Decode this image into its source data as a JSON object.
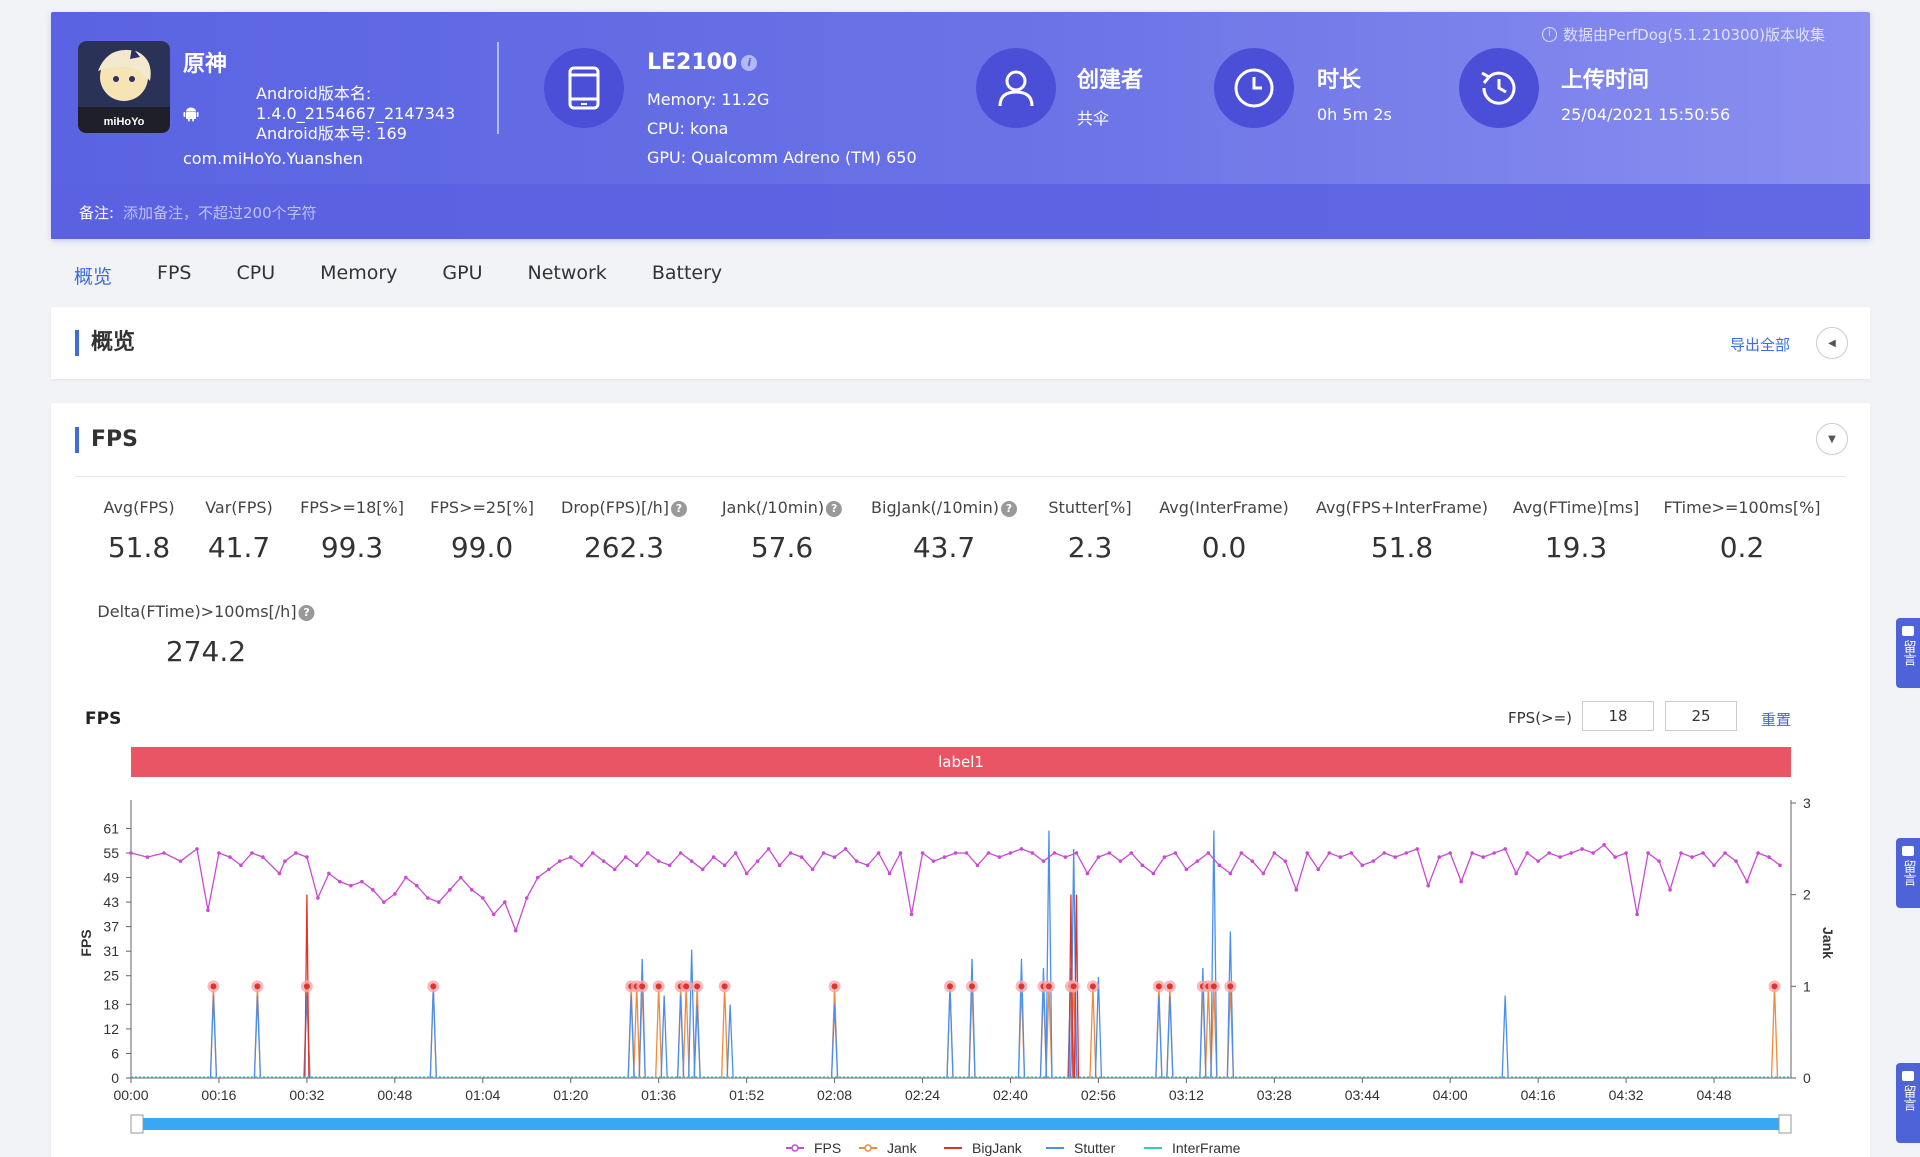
{
  "header": {
    "notice": "数据由PerfDog(5.1.210300)版本收集",
    "game": {
      "name": "原神",
      "version_label": "Android版本名:",
      "version_name": "1.4.0_2154667_2147343",
      "version_code": "Android版本号: 169",
      "package": "com.miHoYo.Yuanshen",
      "icon_text": "miHoYo"
    },
    "device": {
      "name": "LE2100",
      "memory": "Memory: 11.2G",
      "cpu": "CPU: kona",
      "gpu": "GPU: Qualcomm Adreno (TM) 650"
    },
    "creator": {
      "title": "创建者",
      "value": "共伞"
    },
    "duration": {
      "title": "时长",
      "value": "0h 5m 2s"
    },
    "upload": {
      "title": "上传时间",
      "value": "25/04/2021 15:50:56"
    },
    "remark": {
      "label": "备注:",
      "placeholder": "添加备注，不超过200个字符"
    }
  },
  "tabs": [
    "概览",
    "FPS",
    "CPU",
    "Memory",
    "GPU",
    "Network",
    "Battery"
  ],
  "overview": {
    "title": "概览",
    "export_label": "导出全部"
  },
  "fps_section": {
    "title": "FPS",
    "metrics": [
      {
        "label": "Avg(FPS)",
        "value": "51.8",
        "help": false
      },
      {
        "label": "Var(FPS)",
        "value": "41.7",
        "help": false
      },
      {
        "label": "FPS>=18[%]",
        "value": "99.3",
        "help": false
      },
      {
        "label": "FPS>=25[%]",
        "value": "99.0",
        "help": false
      },
      {
        "label": "Drop(FPS)[/h]",
        "value": "262.3",
        "help": true
      },
      {
        "label": "Jank(/10min)",
        "value": "57.6",
        "help": true
      },
      {
        "label": "BigJank(/10min)",
        "value": "43.7",
        "help": true
      },
      {
        "label": "Stutter[%]",
        "value": "2.3",
        "help": false
      },
      {
        "label": "Avg(InterFrame)",
        "value": "0.0",
        "help": false
      },
      {
        "label": "Avg(FPS+InterFrame)",
        "value": "51.8",
        "help": false
      },
      {
        "label": "Avg(FTime)[ms]",
        "value": "19.3",
        "help": false
      },
      {
        "label": "FTime>=100ms[%]",
        "value": "0.2",
        "help": false
      },
      {
        "label": "Delta(FTime)>100ms[/h]",
        "value": "274.2",
        "help": true
      }
    ],
    "chart_label": "FPS",
    "threshold_label": "FPS(>=)",
    "threshold_low": "18",
    "threshold_high": "25",
    "reset_label": "重置",
    "band_label": "label1"
  },
  "side_buttons": [
    "留言",
    "留言",
    "留言"
  ],
  "colors": {
    "fps": "#c94ad3",
    "jank": "#f08a3c",
    "bigjank": "#e0332c",
    "stutter": "#4a8ff0",
    "interframe": "#35c7c7",
    "band": "#ea5565",
    "accent": "#3d6be0"
  },
  "chart_data": {
    "type": "line",
    "title": "FPS",
    "ylabel": "FPS",
    "y2label": "Jank",
    "x_ticks": [
      "00:00",
      "00:16",
      "00:32",
      "00:48",
      "01:04",
      "01:20",
      "01:36",
      "01:52",
      "02:08",
      "02:24",
      "02:40",
      "02:56",
      "03:12",
      "03:28",
      "03:44",
      "04:00",
      "04:16",
      "04:32",
      "04:48"
    ],
    "y_ticks": [
      0,
      6,
      12,
      18,
      25,
      31,
      37,
      43,
      49,
      55,
      61
    ],
    "y2_ticks": [
      0,
      1,
      2,
      3
    ],
    "ylim": [
      0,
      66
    ],
    "y2lim": [
      0,
      3
    ],
    "xlim_seconds": [
      0,
      302
    ],
    "legend": [
      "FPS",
      "Jank",
      "BigJank",
      "Stutter",
      "InterFrame"
    ],
    "legend_position": "bottom",
    "fps_series": [
      [
        0,
        55
      ],
      [
        3,
        54
      ],
      [
        6,
        55
      ],
      [
        9,
        53
      ],
      [
        12,
        56
      ],
      [
        14,
        41
      ],
      [
        16,
        55
      ],
      [
        18,
        54
      ],
      [
        20,
        52
      ],
      [
        22,
        55
      ],
      [
        24,
        54
      ],
      [
        27,
        50
      ],
      [
        28,
        53
      ],
      [
        30,
        55
      ],
      [
        32,
        54
      ],
      [
        34,
        44
      ],
      [
        36,
        50
      ],
      [
        38,
        48
      ],
      [
        40,
        47
      ],
      [
        42,
        48
      ],
      [
        44,
        46
      ],
      [
        46,
        43
      ],
      [
        48,
        45
      ],
      [
        50,
        49
      ],
      [
        52,
        47
      ],
      [
        54,
        44
      ],
      [
        56,
        43
      ],
      [
        58,
        46
      ],
      [
        60,
        49
      ],
      [
        62,
        46
      ],
      [
        64,
        44
      ],
      [
        66,
        40
      ],
      [
        68,
        43
      ],
      [
        70,
        36
      ],
      [
        72,
        44
      ],
      [
        74,
        49
      ],
      [
        76,
        51
      ],
      [
        78,
        53
      ],
      [
        80,
        54
      ],
      [
        82,
        52
      ],
      [
        84,
        55
      ],
      [
        86,
        53
      ],
      [
        88,
        51
      ],
      [
        90,
        54
      ],
      [
        92,
        52
      ],
      [
        94,
        55
      ],
      [
        96,
        53
      ],
      [
        98,
        52
      ],
      [
        100,
        55
      ],
      [
        102,
        53
      ],
      [
        104,
        51
      ],
      [
        106,
        54
      ],
      [
        108,
        52
      ],
      [
        110,
        55
      ],
      [
        112,
        50
      ],
      [
        114,
        53
      ],
      [
        116,
        56
      ],
      [
        118,
        52
      ],
      [
        120,
        55
      ],
      [
        122,
        54
      ],
      [
        124,
        51
      ],
      [
        126,
        55
      ],
      [
        128,
        54
      ],
      [
        130,
        56
      ],
      [
        132,
        53
      ],
      [
        134,
        52
      ],
      [
        136,
        55
      ],
      [
        138,
        50
      ],
      [
        140,
        55
      ],
      [
        142,
        40
      ],
      [
        144,
        55
      ],
      [
        146,
        53
      ],
      [
        148,
        54
      ],
      [
        150,
        55
      ],
      [
        152,
        55
      ],
      [
        154,
        52
      ],
      [
        156,
        55
      ],
      [
        158,
        54
      ],
      [
        160,
        55
      ],
      [
        162,
        56
      ],
      [
        164,
        55
      ],
      [
        166,
        53
      ],
      [
        168,
        55
      ],
      [
        170,
        54
      ],
      [
        172,
        55
      ],
      [
        174,
        50
      ],
      [
        176,
        54
      ],
      [
        178,
        55
      ],
      [
        180,
        53
      ],
      [
        182,
        55
      ],
      [
        184,
        52
      ],
      [
        186,
        50
      ],
      [
        188,
        54
      ],
      [
        190,
        55
      ],
      [
        192,
        51
      ],
      [
        194,
        53
      ],
      [
        196,
        55
      ],
      [
        198,
        52
      ],
      [
        200,
        50
      ],
      [
        202,
        55
      ],
      [
        204,
        53
      ],
      [
        206,
        50
      ],
      [
        208,
        55
      ],
      [
        210,
        53
      ],
      [
        212,
        46
      ],
      [
        214,
        55
      ],
      [
        216,
        51
      ],
      [
        218,
        55
      ],
      [
        220,
        54
      ],
      [
        222,
        55
      ],
      [
        224,
        52
      ],
      [
        226,
        53
      ],
      [
        228,
        55
      ],
      [
        230,
        54
      ],
      [
        232,
        55
      ],
      [
        234,
        56
      ],
      [
        236,
        47
      ],
      [
        238,
        54
      ],
      [
        240,
        55
      ],
      [
        242,
        48
      ],
      [
        244,
        55
      ],
      [
        246,
        54
      ],
      [
        248,
        55
      ],
      [
        250,
        56
      ],
      [
        252,
        50
      ],
      [
        254,
        55
      ],
      [
        256,
        53
      ],
      [
        258,
        55
      ],
      [
        260,
        54
      ],
      [
        262,
        55
      ],
      [
        264,
        56
      ],
      [
        266,
        55
      ],
      [
        268,
        57
      ],
      [
        270,
        54
      ],
      [
        272,
        55
      ],
      [
        274,
        40
      ],
      [
        276,
        55
      ],
      [
        278,
        53
      ],
      [
        280,
        46
      ],
      [
        282,
        55
      ],
      [
        284,
        54
      ],
      [
        286,
        55
      ],
      [
        288,
        52
      ],
      [
        290,
        55
      ],
      [
        292,
        53
      ],
      [
        294,
        48
      ],
      [
        296,
        55
      ],
      [
        298,
        54
      ],
      [
        300,
        52
      ]
    ],
    "series_note_omitted": "FPS, Jank, Stutter sampled approximately from the plot"
  }
}
